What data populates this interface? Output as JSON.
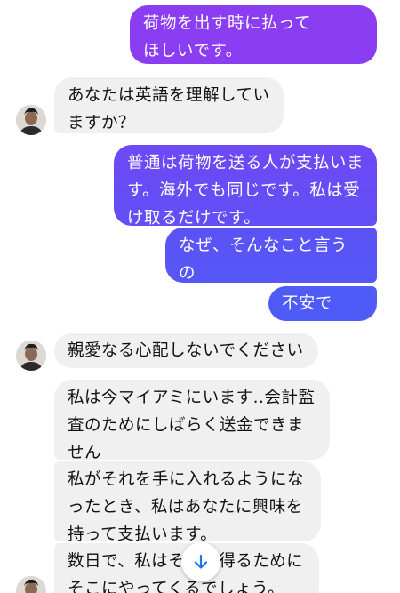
{
  "colors": {
    "sent_top": "#8e3cf2",
    "sent_bottom": "#4f5bf6",
    "received_bg": "#f0f0f0",
    "scroll_arrow": "#1877f2"
  },
  "messages": [
    {
      "side": "sent",
      "text": "荷物を出す時に払って\nほしいです。"
    },
    {
      "side": "received",
      "text": "あなたは英語を理解してい\nますか？"
    },
    {
      "side": "sent",
      "text": "普通は荷物を送る人が支払いま\nす。海外でも同じです。私は受\nけ取るだけです。"
    },
    {
      "side": "sent",
      "text": "なぜ、そんなこと言うの\nですか？"
    },
    {
      "side": "sent",
      "text": "不安です。"
    },
    {
      "side": "received",
      "text": "親愛なる心配しないでください"
    },
    {
      "side": "received",
      "text": "私は今マイアミにいます..会計監\n査のためにしばらく送金できま\nせん"
    },
    {
      "side": "received",
      "text": "私がそれを手に入れるようにな\nったとき、私はあなたに興味を\n持って支払います。"
    },
    {
      "side": "received",
      "text": "数日で、私はそれを得るために\nそこにやってくるでしょう。"
    }
  ],
  "scroll_button": {
    "icon": "arrow-down-icon"
  }
}
